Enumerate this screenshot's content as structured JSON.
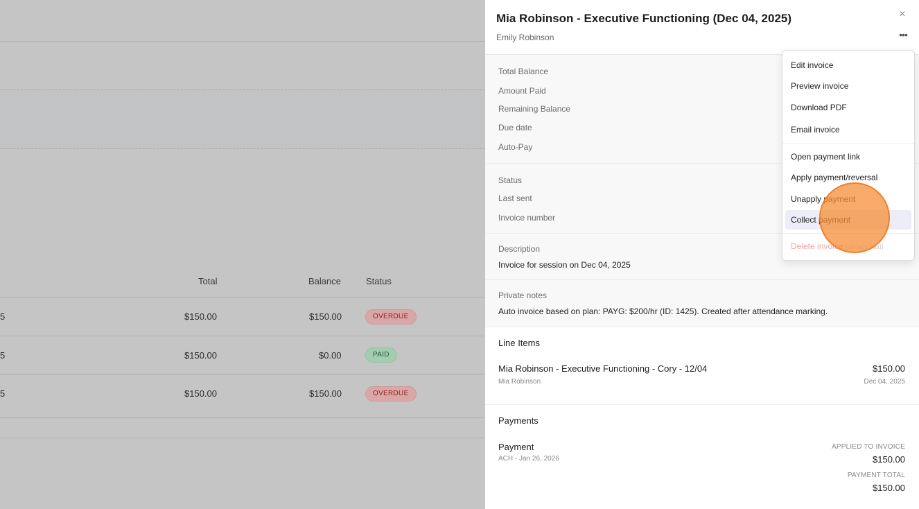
{
  "table": {
    "headers": {
      "total": "Total",
      "balance": "Balance",
      "status": "Status"
    },
    "rows": [
      {
        "date_fragment": "5",
        "total": "$150.00",
        "balance": "$150.00",
        "status": "OVERDUE"
      },
      {
        "date_fragment": "5",
        "total": "$150.00",
        "balance": "$0.00",
        "status": "PAID"
      },
      {
        "date_fragment": "5",
        "total": "$150.00",
        "balance": "$150.00",
        "status": "OVERDUE"
      }
    ]
  },
  "drawer": {
    "title": "Mia Robinson - Executive Functioning (Dec 04, 2025)",
    "subtitle": "Emily Robinson",
    "close_icon": "×",
    "more_icon": "•••",
    "summary": {
      "total_balance_label": "Total Balance",
      "amount_paid_label": "Amount Paid",
      "remaining_balance_label": "Remaining Balance",
      "due_date_label": "Due date",
      "auto_pay_label": "Auto-Pay"
    },
    "meta": {
      "status_label": "Status",
      "last_sent_label": "Last sent",
      "invoice_number_label": "Invoice number"
    },
    "description": {
      "label": "Description",
      "value": "Invoice for session on Dec 04, 2025"
    },
    "private_notes": {
      "label": "Private notes",
      "value": "Auto invoice based on plan: PAYG: $200/hr (ID: 1425). Created after attendance marking."
    },
    "line_items": {
      "title": "Line Items",
      "items": [
        {
          "name": "Mia Robinson - Executive Functioning - Cory - 12/04",
          "sub": "Mia Robinson",
          "amount": "$150.00",
          "date": "Dec 04, 2025"
        }
      ]
    },
    "payments": {
      "title": "Payments",
      "items": [
        {
          "name": "Payment",
          "sub": "ACH - Jan 26, 2026",
          "applied_label": "APPLIED TO INVOICE",
          "applied_value": "$150.00",
          "total_label": "PAYMENT TOTAL",
          "total_value": "$150.00"
        }
      ]
    }
  },
  "menu": {
    "items": [
      "Edit invoice",
      "Preview invoice",
      "Download PDF",
      "Email invoice",
      "Open payment link",
      "Apply payment/reversal",
      "Unapply payment",
      "Collect payment"
    ],
    "delete_label": "Delete invoice",
    "delete_note": "(already paid)"
  },
  "colors": {
    "overdue": "#d9a7a7",
    "paid": "#a4ccb1",
    "click_highlight": "#f68e38",
    "active_menu_item": "#ecedf7",
    "disabled_delete": "#f0a7a7"
  }
}
